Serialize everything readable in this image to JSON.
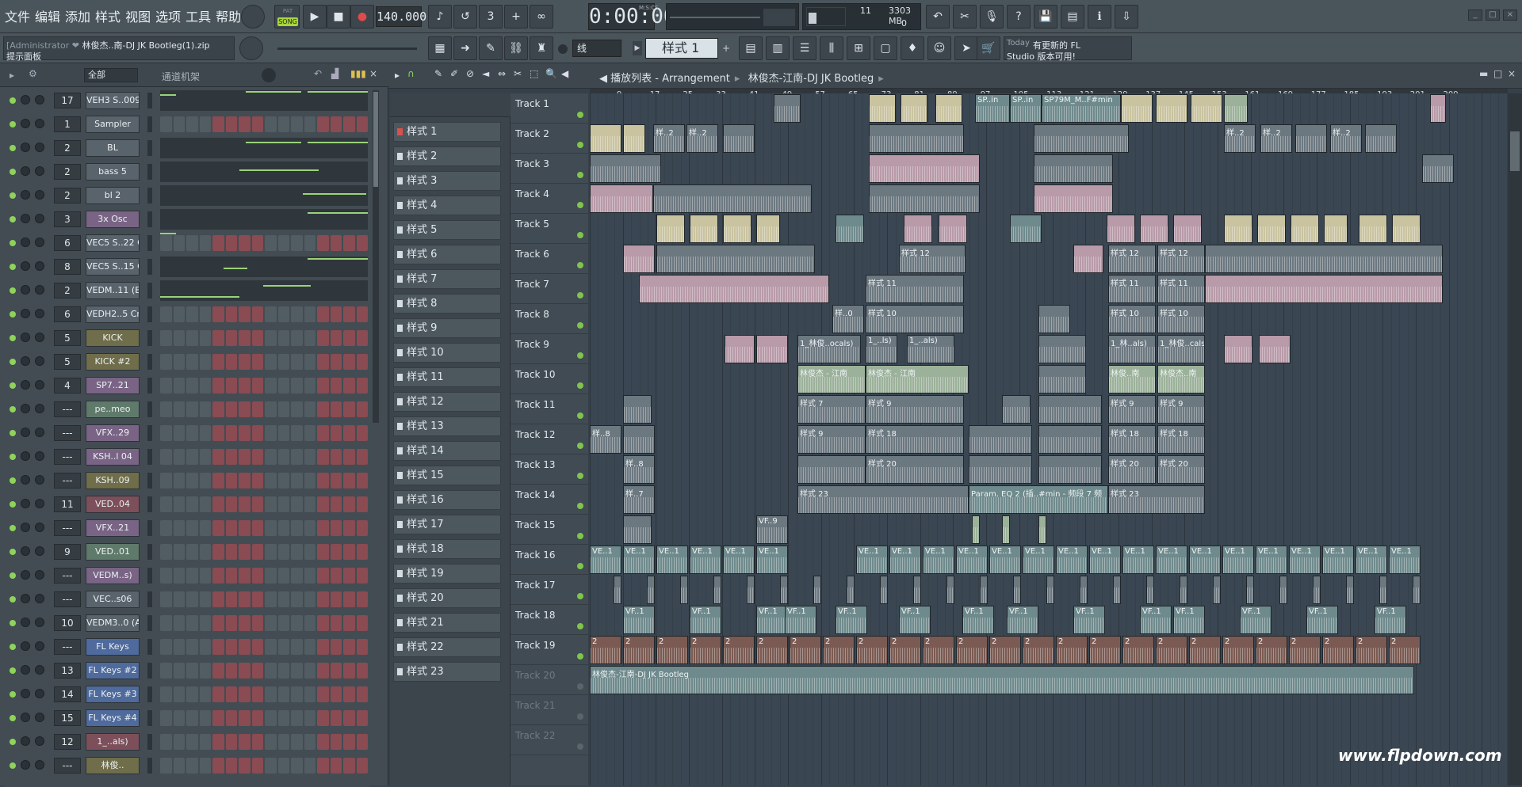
{
  "menu": [
    "文件",
    "编辑",
    "添加",
    "样式",
    "视图",
    "选项",
    "工具",
    "帮助"
  ],
  "transport": {
    "song_mode_small": "PAT",
    "song_mode": "SONG",
    "bpm": "140.000",
    "time": "0:00:00",
    "time_unit": "M:S:CS"
  },
  "cpu": {
    "value_a": "11",
    "memory": "3303 MB",
    "value_b": "0"
  },
  "hint": {
    "user": "[Administrator ❤",
    "file": "林俊杰..南-DJ JK Bootleg(1).zip",
    "panel": "提示面板"
  },
  "snap": {
    "value": "线"
  },
  "pattern_selector": {
    "value": "样式 1"
  },
  "news": {
    "today": "Today",
    "line1": "有更新的 FL",
    "line2": "Studio 版本可用!"
  },
  "channel_rack": {
    "filter": "全部",
    "title": "通道机架",
    "channels": [
      {
        "num": "17",
        "name": "VEH3 S..009",
        "style": "grey",
        "kind": "roll"
      },
      {
        "num": "1",
        "name": "Sampler",
        "style": "grey",
        "kind": "steps"
      },
      {
        "num": "2",
        "name": "BL",
        "style": "grey",
        "kind": "roll"
      },
      {
        "num": "2",
        "name": "bass 5",
        "style": "grey",
        "kind": "roll"
      },
      {
        "num": "2",
        "name": "bl 2",
        "style": "grey",
        "kind": "roll"
      },
      {
        "num": "3",
        "name": "3x Osc",
        "style": "purple",
        "kind": "roll"
      },
      {
        "num": "6",
        "name": "VEC5 S..22 C",
        "style": "grey",
        "kind": "steps"
      },
      {
        "num": "8",
        "name": "VEC5 S..15 C",
        "style": "grey",
        "kind": "roll"
      },
      {
        "num": "2",
        "name": "VEDM..11 (E)",
        "style": "grey",
        "kind": "roll"
      },
      {
        "num": "6",
        "name": "VEDH2..5 Cm",
        "style": "grey",
        "kind": "steps"
      },
      {
        "num": "5",
        "name": "KICK",
        "style": "olive",
        "kind": "steps"
      },
      {
        "num": "5",
        "name": "KICK #2",
        "style": "olive",
        "kind": "steps"
      },
      {
        "num": "4",
        "name": "SP7..21",
        "style": "purple",
        "kind": "steps"
      },
      {
        "num": "---",
        "name": "pe..meo",
        "style": "green",
        "kind": "steps"
      },
      {
        "num": "---",
        "name": "VFX..29",
        "style": "purple",
        "kind": "steps"
      },
      {
        "num": "---",
        "name": "KSH..l 04",
        "style": "purple",
        "kind": "steps"
      },
      {
        "num": "---",
        "name": "KSH..09",
        "style": "olive",
        "kind": "steps"
      },
      {
        "num": "11",
        "name": "VED..04",
        "style": "red",
        "kind": "steps"
      },
      {
        "num": "---",
        "name": "VFX..21",
        "style": "purple",
        "kind": "steps"
      },
      {
        "num": "9",
        "name": "VED..01",
        "style": "green",
        "kind": "steps"
      },
      {
        "num": "---",
        "name": "VEDM..s)",
        "style": "purple",
        "kind": "steps"
      },
      {
        "num": "---",
        "name": "VEC..s06",
        "style": "grey",
        "kind": "steps"
      },
      {
        "num": "10",
        "name": "VEDM3..0 (A)",
        "style": "grey",
        "kind": "steps"
      },
      {
        "num": "---",
        "name": "FL Keys",
        "style": "blue",
        "kind": "steps"
      },
      {
        "num": "13",
        "name": "FL Keys #2",
        "style": "blue",
        "kind": "steps"
      },
      {
        "num": "14",
        "name": "FL Keys #3",
        "style": "blue",
        "kind": "steps"
      },
      {
        "num": "15",
        "name": "FL Keys #4",
        "style": "blue",
        "kind": "steps"
      },
      {
        "num": "12",
        "name": "1_..als)",
        "style": "red",
        "kind": "steps"
      },
      {
        "num": "---",
        "name": "林俊..",
        "style": "olive",
        "kind": "steps"
      }
    ]
  },
  "patterns": [
    "样式 1",
    "样式 2",
    "样式 3",
    "样式 4",
    "样式 5",
    "样式 6",
    "样式 7",
    "样式 8",
    "样式 9",
    "样式 10",
    "样式 11",
    "样式 12",
    "样式 13",
    "样式 14",
    "样式 15",
    "样式 16",
    "样式 17",
    "样式 18",
    "样式 19",
    "样式 20",
    "样式 21",
    "样式 22",
    "样式 23"
  ],
  "playlist": {
    "title": "播放列表 - Arrangement",
    "project": "林俊杰-江南-DJ JK Bootleg",
    "ruler": [
      "9",
      "17",
      "25",
      "33",
      "41",
      "49",
      "57",
      "65",
      "73",
      "81",
      "89",
      "97",
      "105",
      "113",
      "121",
      "129",
      "137",
      "145",
      "153",
      "161",
      "169",
      "177",
      "185",
      "193",
      "201",
      "209"
    ],
    "tracks": [
      "Track 1",
      "Track 2",
      "Track 3",
      "Track 4",
      "Track 5",
      "Track 6",
      "Track 7",
      "Track 8",
      "Track 9",
      "Track 10",
      "Track 11",
      "Track 12",
      "Track 13",
      "Track 14",
      "Track 15",
      "Track 16",
      "Track 17",
      "Track 18",
      "Track 19",
      "Track 20",
      "Track 21",
      "Track 22"
    ],
    "clip_labels": {
      "t1": [
        "SP..in",
        "SP..in",
        "SP79M_M..F#min"
      ],
      "t2": [
        "样..2",
        "样..2",
        "样..2",
        "样..2",
        "样..2"
      ],
      "t6": [
        "样式 12",
        "样式 12",
        "样式 12"
      ],
      "t7": [
        "样式 11",
        "样式 11",
        "样式 11"
      ],
      "t8": [
        "样..0",
        "样式 10",
        "样式 10",
        "样式 10"
      ],
      "t9": [
        "1_林俊..ocals)",
        "1_..ls)",
        "1_..als)",
        "1_林..als)",
        "1_林俊..cals)"
      ],
      "t10": [
        "林俊杰 - 江南",
        "林俊杰 - 江南",
        "林俊..南",
        "林俊杰..南"
      ],
      "t11": [
        "样式 7",
        "样式 9",
        "样式 9",
        "样式 9"
      ],
      "t12": [
        "样..8",
        "样式 9",
        "样式 18",
        "样式 18",
        "样式 18"
      ],
      "t13": [
        "样..8",
        "样式 20",
        "样式 20",
        "样式 20"
      ],
      "t14": [
        "样..7",
        "样式 23",
        "Param. EQ 2 (插..#min - 频段 7 频",
        "样式 23"
      ],
      "t15": [
        "VF..9"
      ],
      "t16": [
        "VE..1"
      ],
      "t18": [
        "VF..1"
      ],
      "t19": [
        "2"
      ],
      "t20": [
        "林俊杰-江南-DJ JK Bootleg"
      ]
    }
  },
  "watermark": "www.flpdown.com",
  "colors": {
    "clip_beige": "#c9c3a0",
    "clip_pink": "#b89aa8",
    "clip_grey": "#6c7880",
    "clip_teal": "#6f8a8c",
    "clip_green": "#9cb19a",
    "clip_brown": "#7a5a52",
    "led_green": "#8ed35a"
  }
}
